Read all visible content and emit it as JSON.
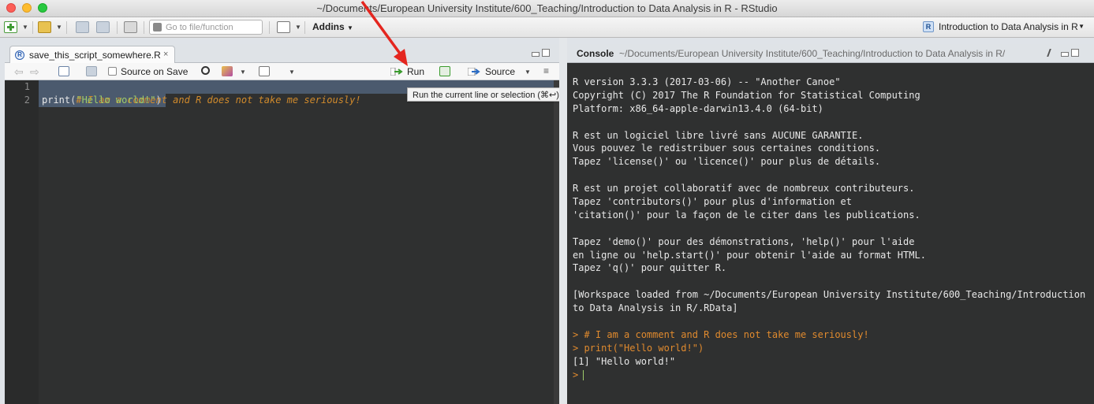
{
  "window": {
    "title": "~/Documents/European University Institute/600_Teaching/Introduction to Data Analysis in R - RStudio"
  },
  "toolbar": {
    "goto_placeholder": "Go to file/function",
    "addins_label": "Addins",
    "project_label": "Introduction to Data Analysis in R"
  },
  "editor": {
    "tab_label": "save_this_script_somewhere.R",
    "tab_close": "×",
    "source_on_save_label": "Source on Save",
    "run_label": "Run",
    "source_label": "Source",
    "lines": [
      {
        "number": "1",
        "comment": "# I am a comment and R does not take me seriously!"
      },
      {
        "number": "2",
        "fn": "print",
        "open": "(",
        "str": "\"Hello world!\"",
        "close": ")"
      }
    ],
    "tooltip": "Run the current line or selection (⌘↩)"
  },
  "console": {
    "title": "Console",
    "path": "~/Documents/European University Institute/600_Teaching/Introduction to Data Analysis in R/",
    "lines": [
      "R version 3.3.3 (2017-03-06) -- \"Another Canoe\"",
      "Copyright (C) 2017 The R Foundation for Statistical Computing",
      "Platform: x86_64-apple-darwin13.4.0 (64-bit)",
      "",
      "R est un logiciel libre livré sans AUCUNE GARANTIE.",
      "Vous pouvez le redistribuer sous certaines conditions.",
      "Tapez 'license()' ou 'licence()' pour plus de détails.",
      "",
      "R est un projet collaboratif avec de nombreux contributeurs.",
      "Tapez 'contributors()' pour plus d'information et",
      "'citation()' pour la façon de le citer dans les publications.",
      "",
      "Tapez 'demo()' pour des démonstrations, 'help()' pour l'aide",
      "en ligne ou 'help.start()' pour obtenir l'aide au format HTML.",
      "Tapez 'q()' pour quitter R.",
      "",
      "[Workspace loaded from ~/Documents/European University Institute/600_Teaching/Introduction",
      "to Data Analysis in R/.RData]",
      ""
    ],
    "echo_lines": [
      "> # I am a comment and R does not take me seriously!",
      "> print(\"Hello world!\")"
    ],
    "output_line": "[1] \"Hello world!\"",
    "prompt": ">"
  },
  "colors": {
    "accent_arrow": "#e4261f",
    "editor_bg": "#2f3030",
    "comment": "#d08a2c",
    "string": "#9fcc6a"
  }
}
